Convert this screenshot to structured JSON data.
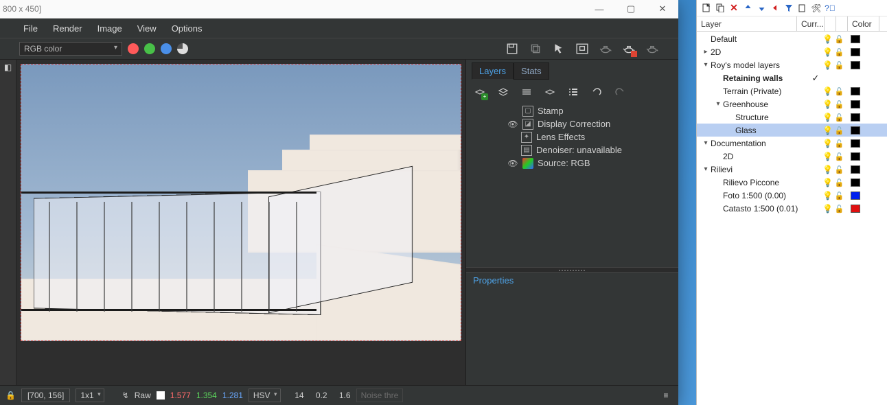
{
  "window": {
    "title": "800 x 450]"
  },
  "menu": [
    "File",
    "Render",
    "Image",
    "View",
    "Options"
  ],
  "toolbar": {
    "mode": "RGB color"
  },
  "rightPanel": {
    "tabs": [
      "Layers",
      "Stats"
    ],
    "tree": {
      "stamp": "Stamp",
      "displayCorrection": "Display Correction",
      "lensEffects": "Lens Effects",
      "denoiser": "Denoiser: unavailable",
      "source": "Source: RGB"
    },
    "properties": "Properties"
  },
  "status": {
    "coords": "[700, 156]",
    "scale": "1x1",
    "raw": "Raw",
    "r": "1.577",
    "g": "1.354",
    "b": "1.281",
    "hsv": "HSV",
    "h": "14",
    "s": "0.2",
    "v": "1.6",
    "noise": "Noise thre"
  },
  "layersPanel": {
    "headers": {
      "layer": "Layer",
      "curr": "Curr...",
      "color": "Color"
    },
    "rows": [
      {
        "name": "Default",
        "indent": 1,
        "exp": "",
        "bold": false,
        "curr": "",
        "bulb": true,
        "lock": true,
        "color": "#000000"
      },
      {
        "name": "2D",
        "indent": 1,
        "exp": "▸",
        "bold": false,
        "curr": "",
        "bulb": true,
        "lock": true,
        "color": "#000000"
      },
      {
        "name": "Roy's model layers",
        "indent": 1,
        "exp": "▾",
        "bold": false,
        "curr": "",
        "bulb": true,
        "lock": true,
        "color": "#000000"
      },
      {
        "name": "Retaining walls",
        "indent": 2,
        "exp": "",
        "bold": true,
        "curr": "✓",
        "bulb": false,
        "lock": false,
        "color": ""
      },
      {
        "name": "Terrain (Private)",
        "indent": 2,
        "exp": "",
        "bold": false,
        "curr": "",
        "bulb": true,
        "lock": true,
        "color": "#000000"
      },
      {
        "name": "Greenhouse",
        "indent": 2,
        "exp": "▾",
        "bold": false,
        "curr": "",
        "bulb": true,
        "lock": true,
        "color": "#000000"
      },
      {
        "name": "Structure",
        "indent": 3,
        "exp": "",
        "bold": false,
        "curr": "",
        "bulb": true,
        "lock": true,
        "color": "#000000"
      },
      {
        "name": "Glass",
        "indent": 3,
        "exp": "",
        "bold": false,
        "selected": true,
        "curr": "",
        "bulb": true,
        "lock": true,
        "color": "#000000"
      },
      {
        "name": "Documentation",
        "indent": 1,
        "exp": "▾",
        "bold": false,
        "curr": "",
        "bulb": true,
        "lock": true,
        "color": "#000000"
      },
      {
        "name": "2D",
        "indent": 2,
        "exp": "",
        "bold": false,
        "curr": "",
        "bulb": true,
        "lock": true,
        "color": "#000000"
      },
      {
        "name": "Rilievi",
        "indent": 1,
        "exp": "▾",
        "bold": false,
        "curr": "",
        "bulb": true,
        "lock": true,
        "color": "#000000"
      },
      {
        "name": "Rilievo Piccone",
        "indent": 2,
        "exp": "",
        "bold": false,
        "curr": "",
        "bulb": true,
        "lock": true,
        "color": "#000000"
      },
      {
        "name": "Foto 1:500 (0.00)",
        "indent": 2,
        "exp": "",
        "bold": false,
        "curr": "",
        "bulb": true,
        "lock": true,
        "color": "#0020ee"
      },
      {
        "name": "Catasto 1:500 (0.01)",
        "indent": 2,
        "exp": "",
        "bold": false,
        "curr": "",
        "bulb": true,
        "lock": true,
        "color": "#e01010"
      }
    ]
  }
}
